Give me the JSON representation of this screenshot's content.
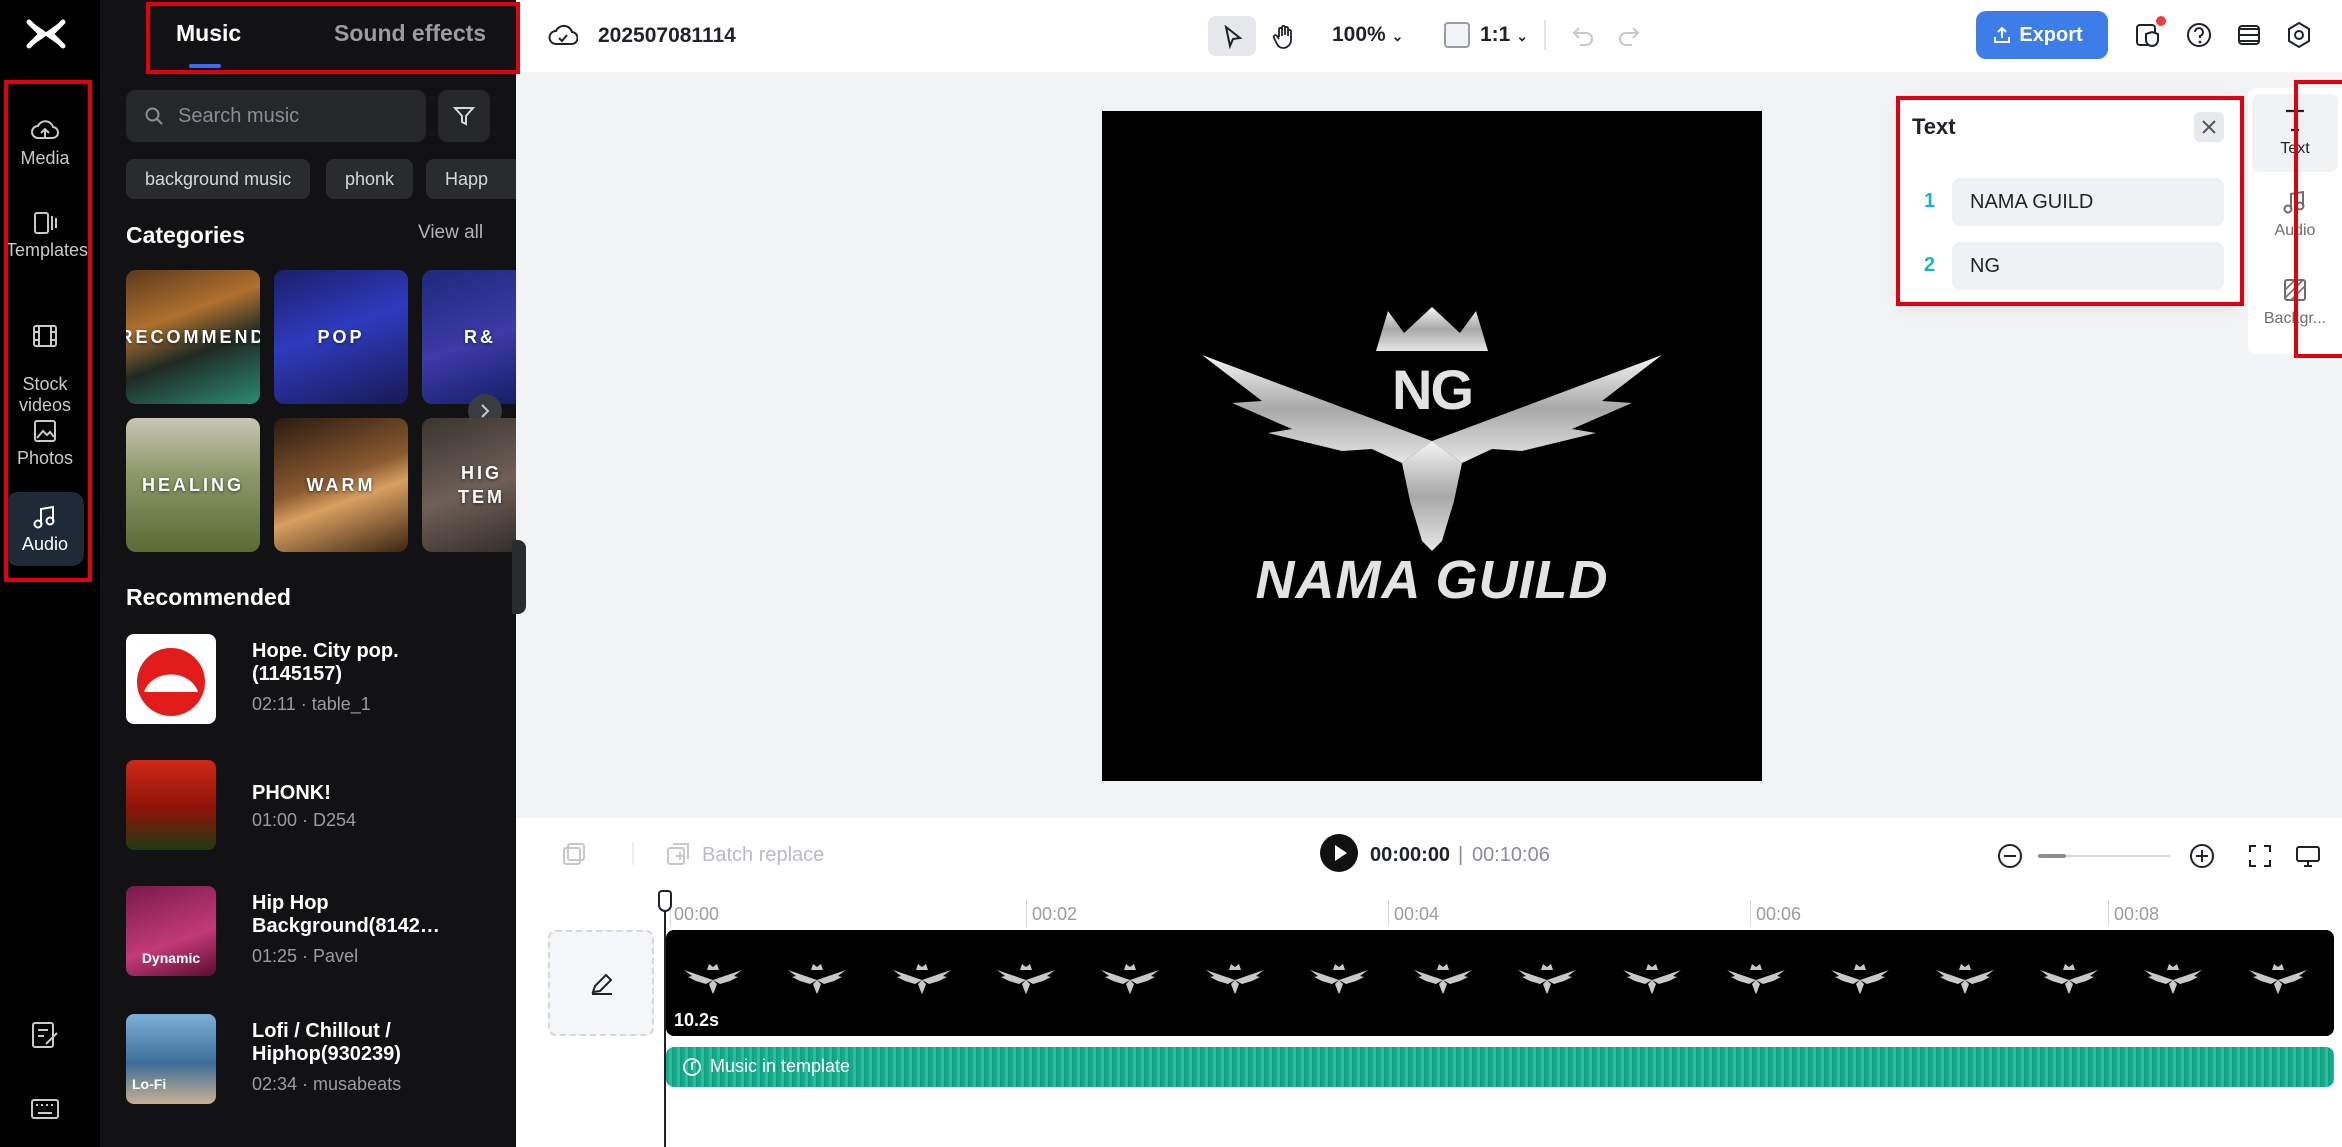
{
  "rail": {
    "items": [
      {
        "label": "Media",
        "icon": "cloud-upload-icon"
      },
      {
        "label": "Templates",
        "icon": "templates-icon"
      },
      {
        "label": "Stock\nvideos",
        "icon": "film-icon"
      },
      {
        "label": "Photos",
        "icon": "image-icon"
      },
      {
        "label": "Audio",
        "icon": "music-note-icon"
      }
    ]
  },
  "panel": {
    "tabs": [
      "Music",
      "Sound effects"
    ],
    "search_placeholder": "Search music",
    "chips": [
      "background music",
      "phonk",
      "Happ"
    ],
    "categories_title": "Categories",
    "view_all": "View all",
    "categories": [
      "RECOMMEND",
      "POP",
      "R&",
      "HEALING",
      "WARM",
      "HIG\nTEM"
    ],
    "recommended_title": "Recommended",
    "tracks": [
      {
        "title": "Hope. City pop. (1145157)",
        "meta": "02:11 · table_1",
        "badge": ""
      },
      {
        "title": "PHONK!",
        "meta": "01:00 · D254",
        "badge": ""
      },
      {
        "title": "Hip Hop Background(8142…",
        "meta": "01:25 · Pavel",
        "badge": "Dynamic"
      },
      {
        "title": "Lofi / Chillout / Hiphop(930239)",
        "meta": "02:34 · musabeats",
        "badge": "Lo-Fi"
      }
    ]
  },
  "topbar": {
    "project_name": "202507081114",
    "zoom": "100%",
    "ratio": "1:1",
    "export_label": "Export"
  },
  "canvas": {
    "monogram": "NG",
    "brand": "NAMA GUILD"
  },
  "text_popup": {
    "title": "Text",
    "entries": [
      {
        "num": "1",
        "value": "NAMA GUILD"
      },
      {
        "num": "2",
        "value": "NG"
      }
    ]
  },
  "right_panel": {
    "items": [
      "Text",
      "Audio",
      "Backgr..."
    ]
  },
  "timeline": {
    "batch_replace": "Batch replace",
    "current_time": "00:00:00",
    "separator": "|",
    "total_time": "00:10:06",
    "ruler": [
      "00:00",
      "00:02",
      "00:04",
      "00:06",
      "00:08"
    ],
    "video_duration": "10.2s",
    "audio_label": "Music in template"
  },
  "colors": {
    "accent": "#3d7de8",
    "highlight_box": "#e0000f",
    "audio_track": "#1aa88a",
    "text_index": "#16b5c6"
  }
}
